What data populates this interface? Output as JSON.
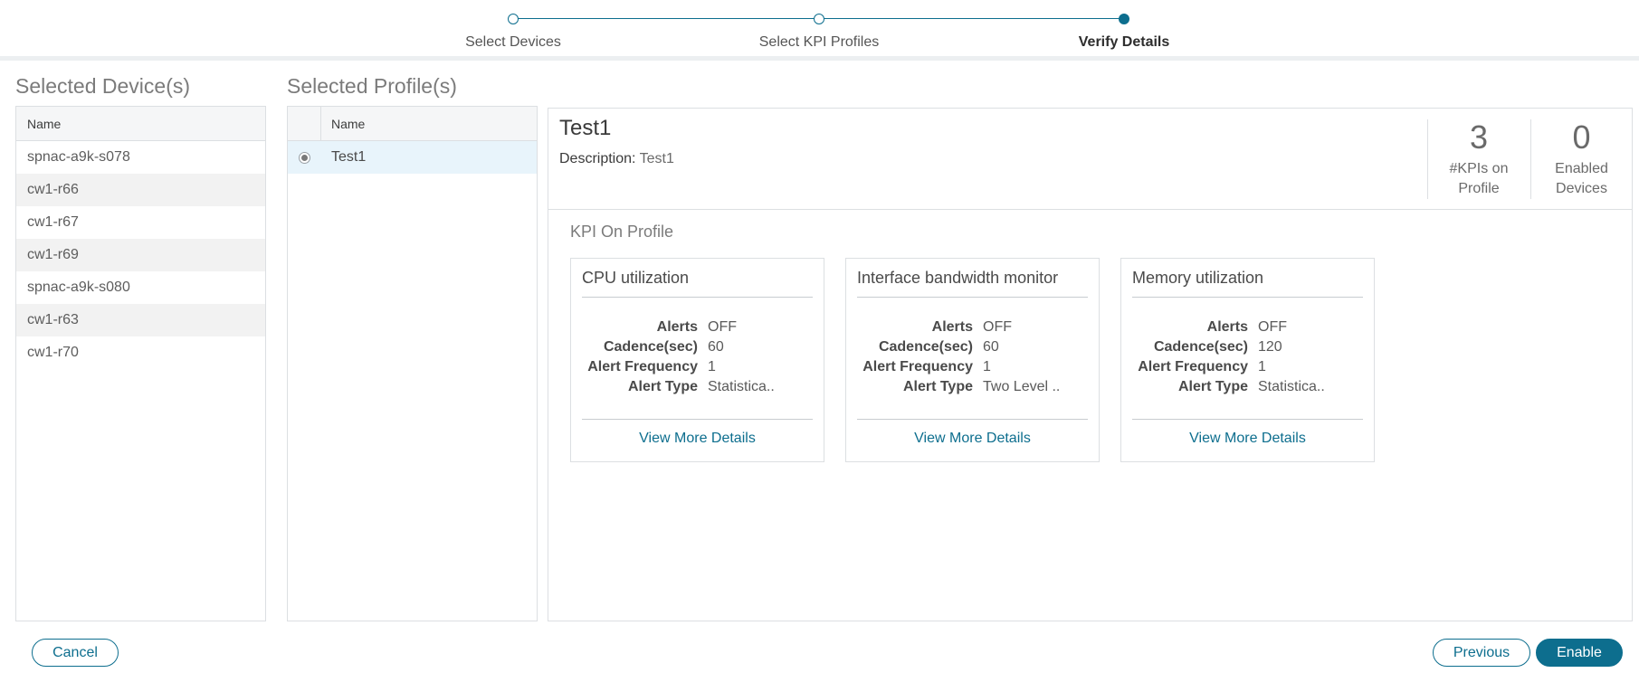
{
  "stepper": {
    "steps": [
      {
        "label": "Select Devices"
      },
      {
        "label": "Select KPI Profiles"
      },
      {
        "label": "Verify Details"
      }
    ],
    "active_step": "Verify Details"
  },
  "devices": {
    "title": "Selected Device(s)",
    "column": "Name",
    "rows": [
      "spnac-a9k-s078",
      "cw1-r66",
      "cw1-r67",
      "cw1-r69",
      "spnac-a9k-s080",
      "cw1-r63",
      "cw1-r70"
    ]
  },
  "profiles": {
    "title": "Selected Profile(s)",
    "column": "Name",
    "rows": [
      {
        "name": "Test1",
        "selected": true
      }
    ]
  },
  "details": {
    "name": "Test1",
    "description_label": "Description:",
    "description": "Test1",
    "stats": {
      "kpis_value": "3",
      "kpis_line1": "#KPIs on",
      "kpis_line2": "Profile",
      "devices_value": "0",
      "devices_line1": "Enabled",
      "devices_line2": "Devices"
    },
    "kpi_section_title": "KPI On Profile",
    "labels": {
      "alerts": "Alerts",
      "cadence": "Cadence(sec)",
      "frequency": "Alert Frequency",
      "type": "Alert Type",
      "view_more": "View More Details"
    },
    "kpis": [
      {
        "title": "CPU utilization",
        "alerts": "OFF",
        "cadence": "60",
        "frequency": "1",
        "type": "Statistica.."
      },
      {
        "title": "Interface bandwidth monitor",
        "alerts": "OFF",
        "cadence": "60",
        "frequency": "1",
        "type": "Two Level .."
      },
      {
        "title": "Memory utilization",
        "alerts": "OFF",
        "cadence": "120",
        "frequency": "1",
        "type": "Statistica.."
      }
    ]
  },
  "footer": {
    "cancel": "Cancel",
    "previous": "Previous",
    "enable": "Enable"
  },
  "colors": {
    "accent": "#0d6e8e",
    "selected_row": "#e8f4fb",
    "alt_row": "#f2f2f2",
    "border": "#dcdfe2"
  }
}
